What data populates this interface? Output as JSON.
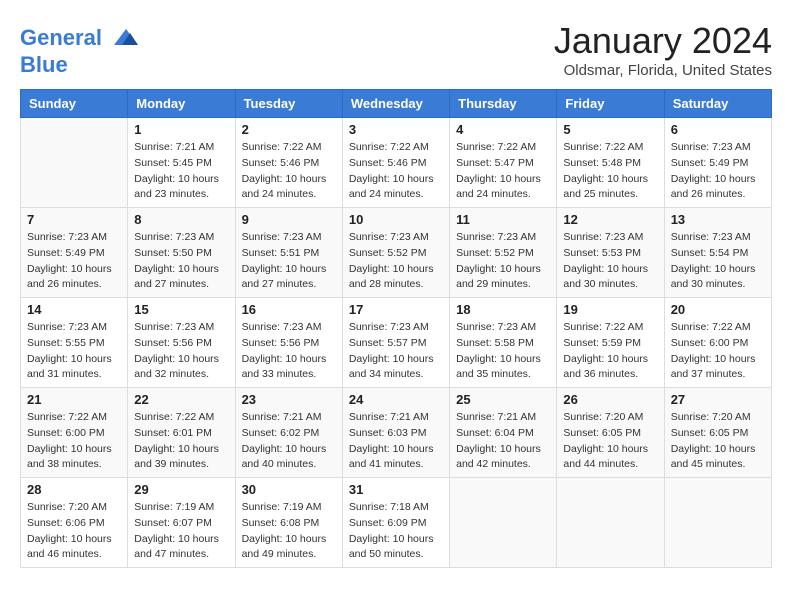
{
  "header": {
    "logo_line1": "General",
    "logo_line2": "Blue",
    "month": "January 2024",
    "location": "Oldsmar, Florida, United States"
  },
  "days_of_week": [
    "Sunday",
    "Monday",
    "Tuesday",
    "Wednesday",
    "Thursday",
    "Friday",
    "Saturday"
  ],
  "weeks": [
    [
      {
        "num": "",
        "sunrise": "",
        "sunset": "",
        "daylight": ""
      },
      {
        "num": "1",
        "sunrise": "7:21 AM",
        "sunset": "5:45 PM",
        "daylight": "10 hours and 23 minutes."
      },
      {
        "num": "2",
        "sunrise": "7:22 AM",
        "sunset": "5:46 PM",
        "daylight": "10 hours and 24 minutes."
      },
      {
        "num": "3",
        "sunrise": "7:22 AM",
        "sunset": "5:46 PM",
        "daylight": "10 hours and 24 minutes."
      },
      {
        "num": "4",
        "sunrise": "7:22 AM",
        "sunset": "5:47 PM",
        "daylight": "10 hours and 24 minutes."
      },
      {
        "num": "5",
        "sunrise": "7:22 AM",
        "sunset": "5:48 PM",
        "daylight": "10 hours and 25 minutes."
      },
      {
        "num": "6",
        "sunrise": "7:23 AM",
        "sunset": "5:49 PM",
        "daylight": "10 hours and 26 minutes."
      }
    ],
    [
      {
        "num": "7",
        "sunrise": "7:23 AM",
        "sunset": "5:49 PM",
        "daylight": "10 hours and 26 minutes."
      },
      {
        "num": "8",
        "sunrise": "7:23 AM",
        "sunset": "5:50 PM",
        "daylight": "10 hours and 27 minutes."
      },
      {
        "num": "9",
        "sunrise": "7:23 AM",
        "sunset": "5:51 PM",
        "daylight": "10 hours and 27 minutes."
      },
      {
        "num": "10",
        "sunrise": "7:23 AM",
        "sunset": "5:52 PM",
        "daylight": "10 hours and 28 minutes."
      },
      {
        "num": "11",
        "sunrise": "7:23 AM",
        "sunset": "5:52 PM",
        "daylight": "10 hours and 29 minutes."
      },
      {
        "num": "12",
        "sunrise": "7:23 AM",
        "sunset": "5:53 PM",
        "daylight": "10 hours and 30 minutes."
      },
      {
        "num": "13",
        "sunrise": "7:23 AM",
        "sunset": "5:54 PM",
        "daylight": "10 hours and 30 minutes."
      }
    ],
    [
      {
        "num": "14",
        "sunrise": "7:23 AM",
        "sunset": "5:55 PM",
        "daylight": "10 hours and 31 minutes."
      },
      {
        "num": "15",
        "sunrise": "7:23 AM",
        "sunset": "5:56 PM",
        "daylight": "10 hours and 32 minutes."
      },
      {
        "num": "16",
        "sunrise": "7:23 AM",
        "sunset": "5:56 PM",
        "daylight": "10 hours and 33 minutes."
      },
      {
        "num": "17",
        "sunrise": "7:23 AM",
        "sunset": "5:57 PM",
        "daylight": "10 hours and 34 minutes."
      },
      {
        "num": "18",
        "sunrise": "7:23 AM",
        "sunset": "5:58 PM",
        "daylight": "10 hours and 35 minutes."
      },
      {
        "num": "19",
        "sunrise": "7:22 AM",
        "sunset": "5:59 PM",
        "daylight": "10 hours and 36 minutes."
      },
      {
        "num": "20",
        "sunrise": "7:22 AM",
        "sunset": "6:00 PM",
        "daylight": "10 hours and 37 minutes."
      }
    ],
    [
      {
        "num": "21",
        "sunrise": "7:22 AM",
        "sunset": "6:00 PM",
        "daylight": "10 hours and 38 minutes."
      },
      {
        "num": "22",
        "sunrise": "7:22 AM",
        "sunset": "6:01 PM",
        "daylight": "10 hours and 39 minutes."
      },
      {
        "num": "23",
        "sunrise": "7:21 AM",
        "sunset": "6:02 PM",
        "daylight": "10 hours and 40 minutes."
      },
      {
        "num": "24",
        "sunrise": "7:21 AM",
        "sunset": "6:03 PM",
        "daylight": "10 hours and 41 minutes."
      },
      {
        "num": "25",
        "sunrise": "7:21 AM",
        "sunset": "6:04 PM",
        "daylight": "10 hours and 42 minutes."
      },
      {
        "num": "26",
        "sunrise": "7:20 AM",
        "sunset": "6:05 PM",
        "daylight": "10 hours and 44 minutes."
      },
      {
        "num": "27",
        "sunrise": "7:20 AM",
        "sunset": "6:05 PM",
        "daylight": "10 hours and 45 minutes."
      }
    ],
    [
      {
        "num": "28",
        "sunrise": "7:20 AM",
        "sunset": "6:06 PM",
        "daylight": "10 hours and 46 minutes."
      },
      {
        "num": "29",
        "sunrise": "7:19 AM",
        "sunset": "6:07 PM",
        "daylight": "10 hours and 47 minutes."
      },
      {
        "num": "30",
        "sunrise": "7:19 AM",
        "sunset": "6:08 PM",
        "daylight": "10 hours and 49 minutes."
      },
      {
        "num": "31",
        "sunrise": "7:18 AM",
        "sunset": "6:09 PM",
        "daylight": "10 hours and 50 minutes."
      },
      {
        "num": "",
        "sunrise": "",
        "sunset": "",
        "daylight": ""
      },
      {
        "num": "",
        "sunrise": "",
        "sunset": "",
        "daylight": ""
      },
      {
        "num": "",
        "sunrise": "",
        "sunset": "",
        "daylight": ""
      }
    ]
  ],
  "labels": {
    "sunrise": "Sunrise:",
    "sunset": "Sunset:",
    "daylight": "Daylight:"
  }
}
